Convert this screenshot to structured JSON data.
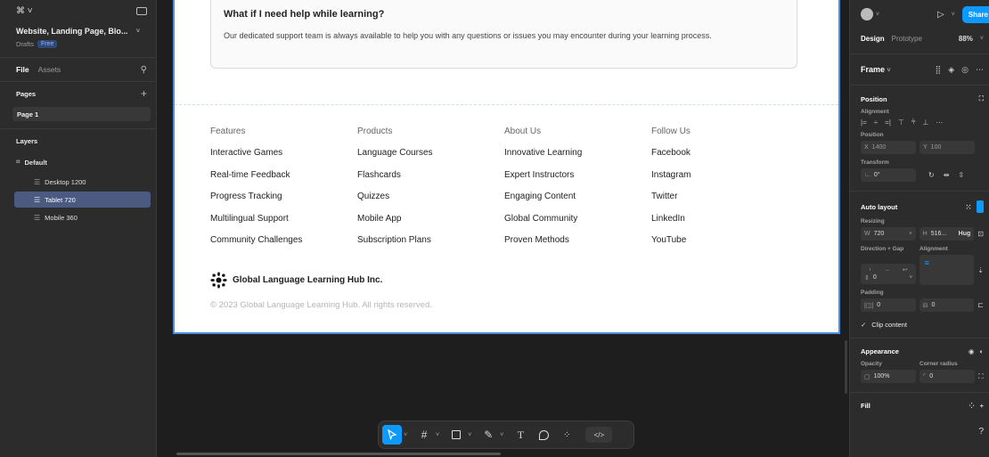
{
  "left_panel": {
    "menu_icon": "figma-menu-icon",
    "file_name": "Website, Landing Page, Blo...",
    "drafts_label": "Drafts",
    "plan_badge": "Free",
    "tabs": [
      "File",
      "Assets"
    ],
    "pages_header": "Pages",
    "pages": [
      "Page 1"
    ],
    "layers_header": "Layers",
    "layers": [
      {
        "label": "Default",
        "level": 0
      },
      {
        "label": "Desktop 1200",
        "level": 1
      },
      {
        "label": "Tablet 720",
        "level": 1,
        "selected": true
      },
      {
        "label": "Mobile 360",
        "level": 1
      }
    ]
  },
  "canvas": {
    "faq": {
      "question": "What if I need help while learning?",
      "answer": "Our dedicated support team is always available to help you with any questions or issues you may encounter during your learning process."
    },
    "footer_columns": [
      {
        "heading": "Features",
        "items": [
          "Interactive Games",
          "Real-time Feedback",
          "Progress Tracking",
          "Multilingual Support",
          "Community Challenges"
        ]
      },
      {
        "heading": "Products",
        "items": [
          "Language Courses",
          "Flashcards",
          "Quizzes",
          "Mobile App",
          "Subscription Plans"
        ]
      },
      {
        "heading": "About Us",
        "items": [
          "Innovative Learning",
          "Expert Instructors",
          "Engaging Content",
          "Global Community",
          "Proven Methods"
        ]
      },
      {
        "heading": "Follow Us",
        "items": [
          "Facebook",
          "Instagram",
          "Twitter",
          "LinkedIn",
          "YouTube"
        ]
      }
    ],
    "brand_name": "Global Language Learning Hub Inc.",
    "copyright": "© 2023 Global Language Learning Hub. All rights reserved."
  },
  "toolbar": {
    "tools": [
      "move-tool",
      "frame-tool",
      "shape-tool",
      "pen-tool",
      "text-tool",
      "comment-tool",
      "actions-tool",
      "dev-mode"
    ],
    "text_tool_glyph": "T",
    "dev_glyph": "</>"
  },
  "right_panel": {
    "share_label": "Share",
    "tabs": [
      "Design",
      "Prototype"
    ],
    "zoom": "88%",
    "frame_label": "Frame",
    "position": {
      "header": "Position",
      "alignment_label": "Alignment",
      "position_label": "Position",
      "x_label": "X",
      "x_value": "1400",
      "y_label": "Y",
      "y_value": "100",
      "transform_label": "Transform",
      "rotation": "0°"
    },
    "auto_layout": {
      "header": "Auto layout",
      "resizing_label": "Resizing",
      "width_label": "W",
      "width_value": "720",
      "height_label": "H",
      "height_value": "516...",
      "height_mode": "Hug",
      "direction_label": "Direction + Gap",
      "alignment_label": "Alignment",
      "gap_value": "0",
      "padding_label": "Padding",
      "padding_h": "0",
      "padding_v": "0",
      "clip_label": "Clip content"
    },
    "appearance": {
      "header": "Appearance",
      "opacity_label": "Opacity",
      "opacity_value": "100%",
      "radius_label": "Corner radius",
      "radius_value": "0"
    },
    "fill_header": "Fill"
  },
  "colors": {
    "accent": "#0d99ff",
    "selection": "#4a5a80",
    "frame_border": "#4b8fe0"
  }
}
